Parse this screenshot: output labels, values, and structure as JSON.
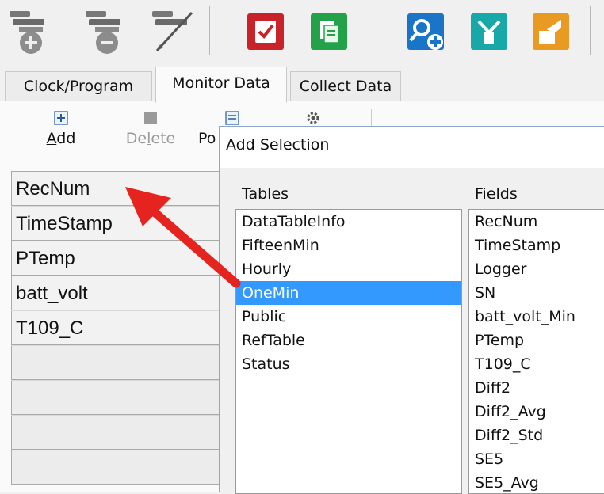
{
  "toolbar": {
    "buttons": [
      {
        "icon": "connect-station-icon"
      },
      {
        "icon": "disconnect-station-icon"
      },
      {
        "icon": "edit-station-icon"
      },
      {
        "icon": "check-program-icon",
        "color": "#c8222b"
      },
      {
        "icon": "copy-document-icon",
        "color": "#24a24a"
      },
      {
        "icon": "search-station-icon",
        "color": "#1a74c8"
      },
      {
        "icon": "network-icon",
        "color": "#18a8a8"
      },
      {
        "icon": "send-file-icon",
        "color": "#e89a22"
      }
    ]
  },
  "tabs": [
    {
      "label": "Clock/Program",
      "active": false
    },
    {
      "label": "Monitor Data",
      "active": true
    },
    {
      "label": "Collect Data",
      "active": false
    }
  ],
  "monitor": {
    "buttons": {
      "add_label": "Add",
      "delete_label": "Delete",
      "po_label": "Po"
    },
    "rows": [
      "RecNum",
      "TimeStamp",
      "PTemp",
      "batt_volt",
      "T109_C",
      "",
      "",
      "",
      ""
    ]
  },
  "dialog": {
    "title": "Add Selection",
    "tables_label": "Tables",
    "fields_label": "Fields",
    "tables": [
      "DataTableInfo",
      "FifteenMin",
      "Hourly",
      "OneMin",
      "Public",
      "RefTable",
      "Status"
    ],
    "selected_table": "OneMin",
    "fields": [
      "RecNum",
      "TimeStamp",
      "Logger",
      "SN",
      "batt_volt_Min",
      "PTemp",
      "T109_C",
      "Diff2",
      "Diff2_Avg",
      "Diff2_Std",
      "SE5",
      "SE5_Avg"
    ]
  },
  "colors": {
    "selection": "#3399ff",
    "arrow": "#e52420"
  }
}
